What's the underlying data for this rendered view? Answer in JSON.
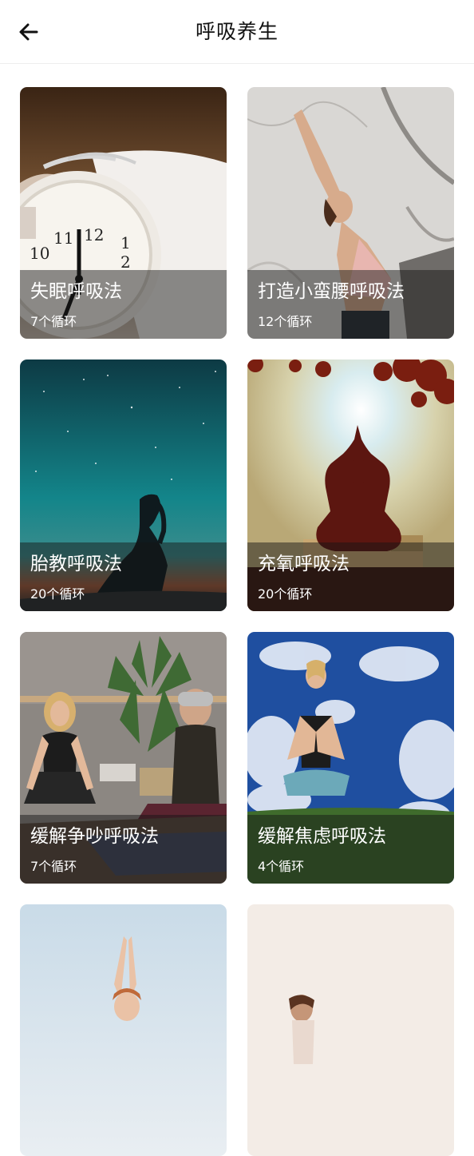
{
  "header": {
    "title": "呼吸养生",
    "back_icon": "arrow-left-icon"
  },
  "cards": [
    {
      "title": "失眠呼吸法",
      "subtitle": "7个循环",
      "image": "alarm-clock-photo"
    },
    {
      "title": "打造小蛮腰呼吸法",
      "subtitle": "12个循环",
      "image": "woman-stretching-photo"
    },
    {
      "title": "胎教呼吸法",
      "subtitle": "20个循环",
      "image": "pregnant-silhouette-photo"
    },
    {
      "title": "充氧呼吸法",
      "subtitle": "20个循环",
      "image": "meditation-sunset-photo"
    },
    {
      "title": "缓解争吵呼吸法",
      "subtitle": "7个循环",
      "image": "couple-meditating-photo"
    },
    {
      "title": "缓解焦虑呼吸法",
      "subtitle": "4个循环",
      "image": "woman-meditating-sky-photo"
    },
    {
      "title": "",
      "subtitle": "",
      "image": "woman-arms-raised-photo"
    },
    {
      "title": "",
      "subtitle": "",
      "image": "woman-yoga-light-photo"
    }
  ]
}
